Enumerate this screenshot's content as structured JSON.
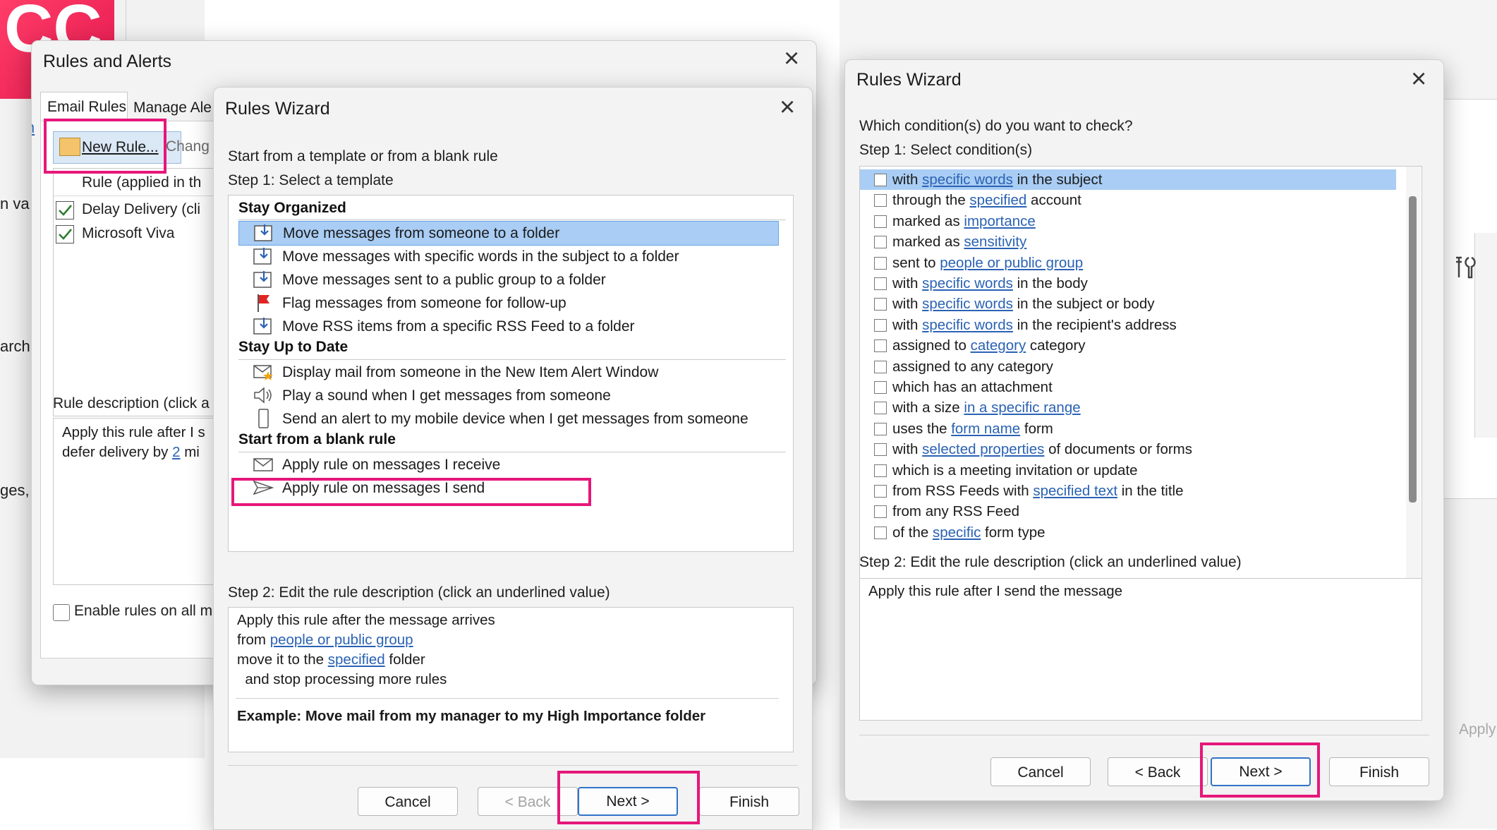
{
  "back": {
    "logo_text": "CC",
    "frag_left": [
      "n va",
      "arch",
      "ges,"
    ],
    "frag_mid": [
      "(",
      "R",
      "ri",
      "is",
      "li",
      "e"
    ],
    "apply_text": "Apply"
  },
  "rules_alerts": {
    "title": "Rules and Alerts",
    "tab_email": "Email Rules",
    "tab_manage": "Manage Ale",
    "link_ch": "Ch",
    "new_rule": "New Rule...",
    "change": "Chang",
    "col_header": "Rule (applied in th",
    "rules": [
      {
        "name": "Delay Delivery  (cli",
        "checked": true
      },
      {
        "name": "Microsoft Viva",
        "checked": true
      }
    ],
    "desc_label": "Rule description (click a",
    "desc_line1": "Apply this rule after I s",
    "desc_line2_pre": "defer delivery by ",
    "desc_line2_link": "2",
    "desc_line2_post": " mi",
    "enable_all": "Enable rules on all m"
  },
  "wizard1": {
    "title": "Rules Wizard",
    "start_label": "Start from a template or from a blank rule",
    "step1": "Step 1: Select a template",
    "groups": [
      {
        "name": "Stay Organized",
        "items": [
          {
            "icon": "move-folder-icon",
            "label": "Move messages from someone to a folder"
          },
          {
            "icon": "move-folder-icon",
            "label": "Move messages with specific words in the subject to a folder"
          },
          {
            "icon": "move-folder-icon",
            "label": "Move messages sent to a public group to a folder"
          },
          {
            "icon": "flag-icon",
            "label": "Flag messages from someone for follow-up"
          },
          {
            "icon": "move-folder-icon",
            "label": "Move RSS items from a specific RSS Feed to a folder"
          }
        ]
      },
      {
        "name": "Stay Up to Date",
        "items": [
          {
            "icon": "alert-window-icon",
            "label": "Display mail from someone in the New Item Alert Window"
          },
          {
            "icon": "speaker-icon",
            "label": "Play a sound when I get messages from someone"
          },
          {
            "icon": "mobile-device-icon",
            "label": "Send an alert to my mobile device when I get messages from someone"
          }
        ]
      },
      {
        "name": "Start from a blank rule",
        "items": [
          {
            "icon": "envelope-icon",
            "label": "Apply rule on messages I receive"
          },
          {
            "icon": "send-icon",
            "label": "Apply rule on messages I send"
          }
        ]
      }
    ],
    "step2": "Step 2: Edit the rule description (click an underlined value)",
    "desc": {
      "l1": "Apply this rule after the message arrives",
      "l2_pre": "from ",
      "l2_link": "people or public group",
      "l3_pre": "move it to the ",
      "l3_link": "specified",
      "l3_post": " folder",
      "l4": "  and stop processing more rules"
    },
    "example": "Example: Move mail from my manager to my High Importance folder",
    "buttons": {
      "cancel": "Cancel",
      "back": "< Back",
      "next": "Next >",
      "finish": "Finish"
    }
  },
  "wizard2": {
    "title": "Rules Wizard",
    "question": "Which condition(s) do you want to check?",
    "step1": "Step 1: Select condition(s)",
    "conditions": [
      {
        "pre": "with ",
        "link": "specific words",
        "post": " in the subject"
      },
      {
        "pre": "through the ",
        "link": "specified",
        "post": " account"
      },
      {
        "pre": "marked as ",
        "link": "importance",
        "post": ""
      },
      {
        "pre": "marked as ",
        "link": "sensitivity",
        "post": ""
      },
      {
        "pre": "sent to ",
        "link": "people or public group",
        "post": ""
      },
      {
        "pre": "with ",
        "link": "specific words",
        "post": " in the body"
      },
      {
        "pre": "with ",
        "link": "specific words",
        "post": " in the subject or body"
      },
      {
        "pre": "with ",
        "link": "specific words",
        "post": " in the recipient's address"
      },
      {
        "pre": "assigned to ",
        "link": "category",
        "post": " category"
      },
      {
        "pre": "assigned to any category",
        "link": "",
        "post": ""
      },
      {
        "pre": "which has an attachment",
        "link": "",
        "post": ""
      },
      {
        "pre": "with a size ",
        "link": "in a specific range",
        "post": ""
      },
      {
        "pre": "uses the ",
        "link": "form name",
        "post": " form"
      },
      {
        "pre": "with ",
        "link": "selected properties",
        "post": " of documents or forms"
      },
      {
        "pre": "which is a meeting invitation or update",
        "link": "",
        "post": ""
      },
      {
        "pre": "from RSS Feeds with ",
        "link": "specified text",
        "post": " in the title"
      },
      {
        "pre": "from any RSS Feed",
        "link": "",
        "post": ""
      },
      {
        "pre": "of the ",
        "link": "specific",
        "post": " form type"
      }
    ],
    "step2": "Step 2: Edit the rule description (click an underlined value)",
    "desc": "Apply this rule after I send the message",
    "buttons": {
      "cancel": "Cancel",
      "back": "< Back",
      "next": "Next >",
      "finish": "Finish"
    }
  }
}
